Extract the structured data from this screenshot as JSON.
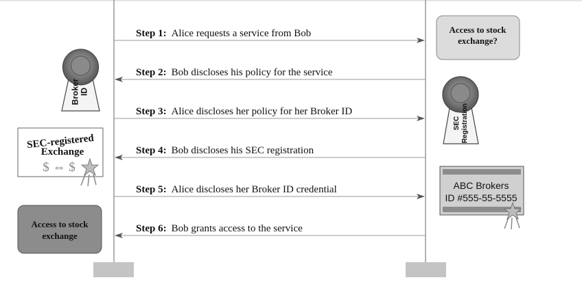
{
  "steps": [
    {
      "num": "Step 1:",
      "text": "Alice requests a service from Bob"
    },
    {
      "num": "Step 2:",
      "text": "Bob discloses his policy for the service"
    },
    {
      "num": "Step 3:",
      "text": "Alice discloses her policy for her Broker ID"
    },
    {
      "num": "Step 4:",
      "text": "Bob discloses his SEC registration"
    },
    {
      "num": "Step 5:",
      "text": "Alice discloses her Broker ID credential"
    },
    {
      "num": "Step 6:",
      "text": "Bob grants access to the service"
    }
  ],
  "bob_request_box": {
    "line1": "Access to stock",
    "line2": "exchange?"
  },
  "alice_grant_box": {
    "line1": "Access to stock",
    "line2": "exchange"
  },
  "broker_lock_label": {
    "line1": "Broker",
    "line2": "ID"
  },
  "sec_lock_label": {
    "line1": "SEC",
    "line2": "Registration"
  },
  "sec_exchange_card": {
    "line1": "SEC-registered",
    "line2": "Exchange",
    "symbol": "$ ⇔ $"
  },
  "broker_card": {
    "line1": "ABC Brokers",
    "line2": "ID #555-55-5555"
  },
  "colors": {
    "line": "#999999",
    "box_light": "#dcdcdc",
    "box_dark": "#8c8c8c",
    "lock": "#7a7a7a"
  }
}
